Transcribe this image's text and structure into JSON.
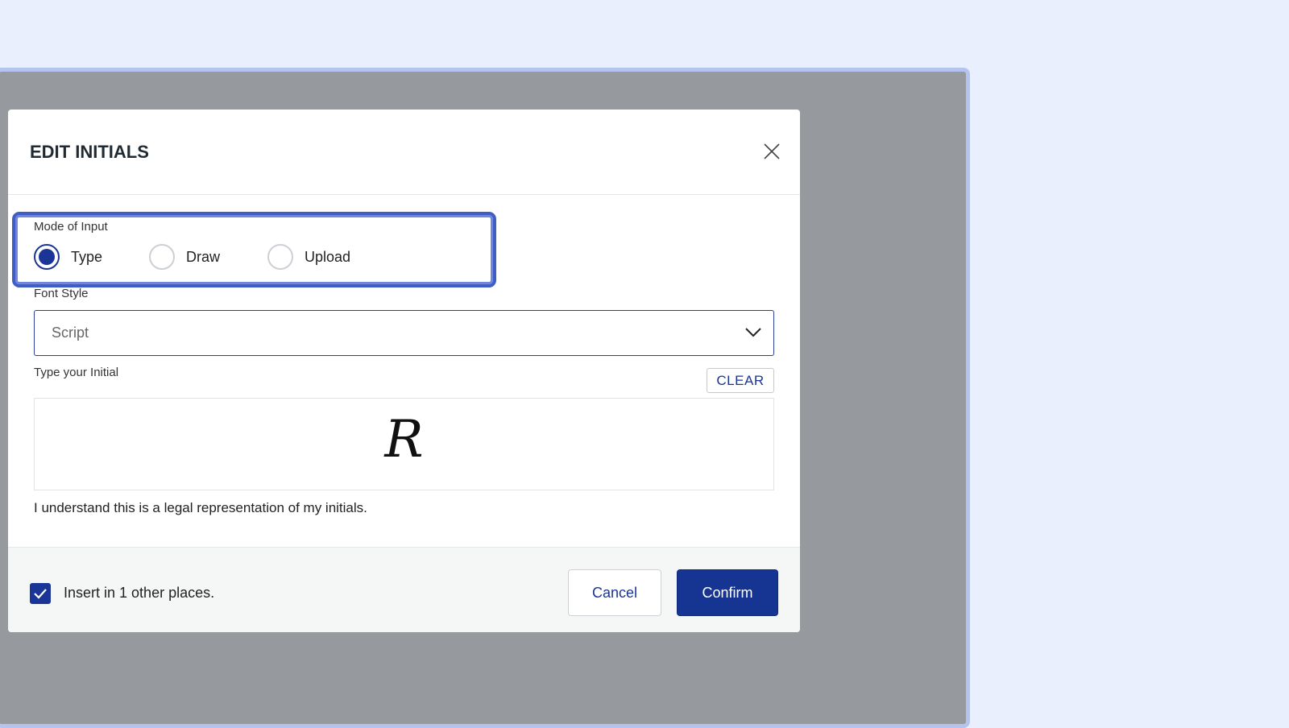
{
  "dialog": {
    "title": "EDIT INITIALS",
    "mode": {
      "label": "Mode of Input",
      "options": [
        "Type",
        "Draw",
        "Upload"
      ],
      "selected": "Type"
    },
    "font_style": {
      "label": "Font Style",
      "value": "Script"
    },
    "initial": {
      "label": "Type your Initial",
      "clear": "CLEAR",
      "value": "R"
    },
    "legal": "I understand this is a legal representation of my initials.",
    "footer": {
      "insert_label": "Insert in 1 other places.",
      "insert_checked": true,
      "cancel": "Cancel",
      "confirm": "Confirm"
    }
  },
  "colors": {
    "accent": "#163592",
    "highlight": "#3f5dc4",
    "overlay": "#969a9e",
    "background": "#e9effd"
  }
}
